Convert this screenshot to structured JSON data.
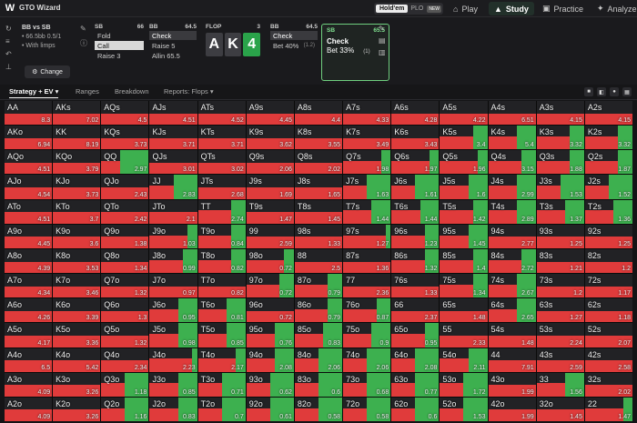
{
  "topbar": {
    "logo": "W",
    "brand": "GTO Wizard",
    "mode_active": "Hold'em",
    "mode_inactive": "PLO",
    "mode_badge": "NEW",
    "nav": [
      {
        "label": "Play",
        "icon": "⌂"
      },
      {
        "label": "Study",
        "icon": "▲"
      },
      {
        "label": "Practice",
        "icon": "▣"
      },
      {
        "label": "Analyze",
        "icon": "✦"
      }
    ]
  },
  "spot": {
    "title": "BB vs SB",
    "line1": "• 66.5bb 0.5/1",
    "line2": "• With limps",
    "change_label": "Change"
  },
  "columns": {
    "sb": {
      "pos": "SB",
      "stack": "66",
      "actions": [
        "Fold",
        "Call",
        "Raise 3"
      ]
    },
    "bb": {
      "pos": "BB",
      "stack": "64.5",
      "actions": [
        "Check",
        "Raise 5",
        "Allin 65.5"
      ]
    },
    "flop": {
      "pos": "FLOP",
      "pot": "3",
      "cards": [
        "A",
        "K",
        "4"
      ]
    },
    "bb2": {
      "pos": "BB",
      "stack": "64.5",
      "actions": [
        "Check",
        "Bet 40%"
      ],
      "bet_sub": "(1.2)"
    },
    "sb2": {
      "pos": "SB",
      "stack": "65.5",
      "actions": [
        "Check",
        "Bet 33%"
      ],
      "bet_sub": "(1)"
    }
  },
  "tabs": [
    "Strategy + EV",
    "Ranges",
    "Breakdown",
    "Reports: Flops"
  ],
  "colors": {
    "check": "#e03b3b",
    "bet": "#3db04f"
  },
  "grid": [
    [
      [
        "AA",
        0,
        "8.3"
      ],
      [
        "AKs",
        0,
        "7.02"
      ],
      [
        "AQs",
        0,
        "4.5"
      ],
      [
        "AJs",
        0,
        "4.51"
      ],
      [
        "ATs",
        0,
        "4.52"
      ],
      [
        "A9s",
        0,
        "4.45"
      ],
      [
        "A8s",
        0,
        "4.4"
      ],
      [
        "A7s",
        0,
        "4.33"
      ],
      [
        "A6s",
        0,
        "4.28"
      ],
      [
        "A5s",
        0,
        "4.22"
      ],
      [
        "A4s",
        0,
        "6.51"
      ],
      [
        "A3s",
        0,
        "4.15"
      ],
      [
        "A2s",
        0,
        "4.15"
      ]
    ],
    [
      [
        "AKo",
        0,
        "6.94"
      ],
      [
        "KK",
        0,
        "8.19"
      ],
      [
        "KQs",
        0,
        "3.73"
      ],
      [
        "KJs",
        0,
        "3.71"
      ],
      [
        "KTs",
        0,
        "3.71"
      ],
      [
        "K9s",
        0,
        "3.62"
      ],
      [
        "K8s",
        0,
        "3.55"
      ],
      [
        "K7s",
        0,
        "3.49"
      ],
      [
        "K6s",
        0,
        "3.43"
      ],
      [
        "K5s",
        0.3,
        "3.4"
      ],
      [
        "K4s",
        0.4,
        "5.4"
      ],
      [
        "K3s",
        0.3,
        "3.32"
      ],
      [
        "K2s",
        0.3,
        "3.32"
      ]
    ],
    [
      [
        "AQo",
        0,
        "4.51"
      ],
      [
        "KQo",
        0,
        "3.79"
      ],
      [
        "QQ",
        0.6,
        "2.97"
      ],
      [
        "QJs",
        0,
        "3.01"
      ],
      [
        "QTs",
        0,
        "3.02"
      ],
      [
        "Q9s",
        0,
        "2.06"
      ],
      [
        "Q8s",
        0,
        "2.02"
      ],
      [
        "Q7s",
        0.2,
        "1.98"
      ],
      [
        "Q6s",
        0.2,
        "1.97"
      ],
      [
        "Q5s",
        0.2,
        "1.96"
      ],
      [
        "Q4s",
        0.3,
        "3.15"
      ],
      [
        "Q3s",
        0.3,
        "1.88"
      ],
      [
        "Q2s",
        0.3,
        "1.87"
      ]
    ],
    [
      [
        "AJo",
        0,
        "4.54"
      ],
      [
        "KJo",
        0,
        "3.73"
      ],
      [
        "QJo",
        0,
        "2.43"
      ],
      [
        "JJ",
        0.5,
        "2.83"
      ],
      [
        "JTs",
        0,
        "2.68"
      ],
      [
        "J9s",
        0,
        "1.69"
      ],
      [
        "J8s",
        0,
        "1.65"
      ],
      [
        "J7s",
        0.5,
        "1.63"
      ],
      [
        "J6s",
        0.5,
        "1.61"
      ],
      [
        "J5s",
        0.4,
        "1.6"
      ],
      [
        "J4s",
        0.4,
        "2.99"
      ],
      [
        "J3s",
        0.5,
        "1.53"
      ],
      [
        "J2s",
        0.5,
        "1.52"
      ]
    ],
    [
      [
        "ATo",
        0,
        "4.51"
      ],
      [
        "KTo",
        0,
        "3.7"
      ],
      [
        "QTo",
        0,
        "2.42"
      ],
      [
        "JTo",
        0,
        "2.1"
      ],
      [
        "TT",
        0.3,
        "2.74"
      ],
      [
        "T9s",
        0,
        "1.47"
      ],
      [
        "T8s",
        0,
        "1.45"
      ],
      [
        "T7s",
        0.4,
        "1.44"
      ],
      [
        "T6s",
        0.4,
        "1.44"
      ],
      [
        "T5s",
        0.3,
        "1.42"
      ],
      [
        "T4s",
        0.4,
        "2.89"
      ],
      [
        "T3s",
        0.4,
        "1.37"
      ],
      [
        "T2s",
        0.4,
        "1.36"
      ]
    ],
    [
      [
        "A9o",
        0,
        "4.45"
      ],
      [
        "K9o",
        0,
        "3.6"
      ],
      [
        "Q9o",
        0,
        "1.38"
      ],
      [
        "J9o",
        0.2,
        "1.03"
      ],
      [
        "T9o",
        0.3,
        "0.84"
      ],
      [
        "99",
        0,
        "2.59"
      ],
      [
        "98s",
        0,
        "1.33"
      ],
      [
        "97s",
        0.1,
        "1.27"
      ],
      [
        "96s",
        0.3,
        "1.23"
      ],
      [
        "95s",
        0.4,
        "1.45"
      ],
      [
        "94s",
        0,
        "2.77"
      ],
      [
        "93s",
        0,
        "1.25"
      ],
      [
        "92s",
        0,
        "1.25"
      ]
    ],
    [
      [
        "A8o",
        0,
        "4.39"
      ],
      [
        "K8o",
        0,
        "3.53"
      ],
      [
        "Q8o",
        0,
        "1.34"
      ],
      [
        "J8o",
        0.3,
        "0.99"
      ],
      [
        "T8o",
        0.3,
        "0.82"
      ],
      [
        "98o",
        0.2,
        "0.72"
      ],
      [
        "88",
        0,
        "2.5"
      ],
      [
        "87s",
        0,
        "1.36"
      ],
      [
        "86s",
        0.3,
        "1.32"
      ],
      [
        "85s",
        0.3,
        "1.4"
      ],
      [
        "84s",
        0.3,
        "2.72"
      ],
      [
        "83s",
        0,
        "1.21"
      ],
      [
        "82s",
        0,
        "1.2"
      ]
    ],
    [
      [
        "A7o",
        0,
        "4.34"
      ],
      [
        "K7o",
        0,
        "3.46"
      ],
      [
        "Q7o",
        0,
        "1.32"
      ],
      [
        "J7o",
        0,
        "0.97"
      ],
      [
        "T7o",
        0,
        "0.82"
      ],
      [
        "97o",
        0.3,
        "0.72"
      ],
      [
        "87o",
        0.3,
        "0.79"
      ],
      [
        "77",
        0,
        "2.36"
      ],
      [
        "76s",
        0,
        "1.33"
      ],
      [
        "75s",
        0.3,
        "1.34"
      ],
      [
        "74s",
        0.4,
        "2.67"
      ],
      [
        "73s",
        0,
        "1.2"
      ],
      [
        "72s",
        0,
        "1.17"
      ]
    ],
    [
      [
        "A6o",
        0,
        "4.26"
      ],
      [
        "K6o",
        0,
        "3.39"
      ],
      [
        "Q6o",
        0,
        "1.3"
      ],
      [
        "J6o",
        0.4,
        "0.95"
      ],
      [
        "T6o",
        0.4,
        "0.81"
      ],
      [
        "96o",
        0,
        "0.72"
      ],
      [
        "86o",
        0.3,
        "0.79"
      ],
      [
        "76o",
        0.3,
        "0.87"
      ],
      [
        "66",
        0,
        "2.37"
      ],
      [
        "65s",
        0,
        "1.48"
      ],
      [
        "64s",
        0.4,
        "2.65"
      ],
      [
        "63s",
        0,
        "1.27"
      ],
      [
        "62s",
        0,
        "1.18"
      ]
    ],
    [
      [
        "A5o",
        0,
        "4.17"
      ],
      [
        "K5o",
        0,
        "3.36"
      ],
      [
        "Q5o",
        0,
        "1.32"
      ],
      [
        "J5o",
        0.4,
        "0.98"
      ],
      [
        "T5o",
        0.4,
        "0.85"
      ],
      [
        "95o",
        0.4,
        "0.76"
      ],
      [
        "85o",
        0.4,
        "0.83"
      ],
      [
        "75o",
        0.4,
        "0.9"
      ],
      [
        "65o",
        0.3,
        "0.95"
      ],
      [
        "55",
        0,
        "2.33"
      ],
      [
        "54s",
        0,
        "1.48"
      ],
      [
        "53s",
        0,
        "2.24"
      ],
      [
        "52s",
        0,
        "2.07"
      ]
    ],
    [
      [
        "A4o",
        0,
        "6.5"
      ],
      [
        "K4o",
        0,
        "5.42"
      ],
      [
        "Q4o",
        0,
        "2.34"
      ],
      [
        "J4o",
        0.1,
        "2.23"
      ],
      [
        "T4o",
        0.2,
        "2.17"
      ],
      [
        "94o",
        0.4,
        "2.08"
      ],
      [
        "84o",
        0.5,
        "2.06"
      ],
      [
        "74o",
        0.5,
        "2.06"
      ],
      [
        "64o",
        0.5,
        "2.08"
      ],
      [
        "54o",
        0.4,
        "2.11"
      ],
      [
        "44",
        0,
        "7.91"
      ],
      [
        "43s",
        0,
        "2.59"
      ],
      [
        "42s",
        0,
        "2.58"
      ]
    ],
    [
      [
        "A3o",
        0,
        "4.09"
      ],
      [
        "K3o",
        0,
        "3.26"
      ],
      [
        "Q3o",
        0.5,
        "1.18"
      ],
      [
        "J3o",
        0.4,
        "0.85"
      ],
      [
        "T3o",
        0.5,
        "0.71"
      ],
      [
        "93o",
        0.5,
        "0.62"
      ],
      [
        "83o",
        0.5,
        "0.6"
      ],
      [
        "73o",
        0.5,
        "0.68"
      ],
      [
        "63o",
        0.5,
        "0.77"
      ],
      [
        "53o",
        0.5,
        "1.72"
      ],
      [
        "43o",
        0,
        "1.99"
      ],
      [
        "33",
        0.4,
        "1.56"
      ],
      [
        "32s",
        0,
        "2.02"
      ]
    ],
    [
      [
        "A2o",
        0,
        "4.09"
      ],
      [
        "K2o",
        0,
        "3.26"
      ],
      [
        "Q2o",
        0.5,
        "1.16"
      ],
      [
        "J2o",
        0.4,
        "0.83"
      ],
      [
        "T2o",
        0.5,
        "0.7"
      ],
      [
        "92o",
        0.5,
        "0.61"
      ],
      [
        "82o",
        0.5,
        "0.58"
      ],
      [
        "72o",
        0.5,
        "0.58"
      ],
      [
        "62o",
        0.5,
        "0.6"
      ],
      [
        "52o",
        0.5,
        "1.53"
      ],
      [
        "42o",
        0,
        "1.99"
      ],
      [
        "32o",
        0,
        "1.45"
      ],
      [
        "22",
        0.2,
        "1.47"
      ]
    ]
  ]
}
